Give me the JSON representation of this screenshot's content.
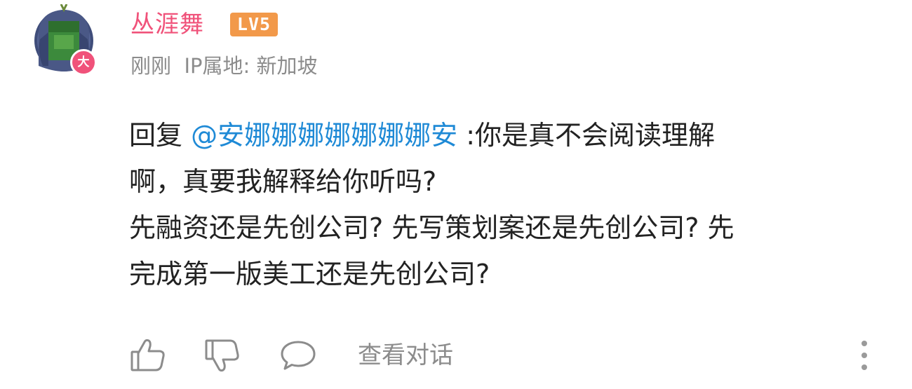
{
  "user": {
    "name": "丛涯舞",
    "level_badge": "LV5",
    "avatar_badge_text": "大",
    "name_color": "#f0527a"
  },
  "meta": {
    "time": "刚刚",
    "ip_location": "IP属地: 新加坡"
  },
  "comment": {
    "reply_prefix": "回复",
    "mention": "@安娜娜娜娜娜娜娜安",
    "line1_rest": ":你是真不会阅读理解",
    "line2": "啊，真要我解释给你听吗?",
    "line3": "先融资还是先创公司? 先写策划案还是先创公司? 先",
    "line4": "完成第一版美工还是先创公司?"
  },
  "actions": {
    "like_icon": "thumbs-up-icon",
    "dislike_icon": "thumbs-down-icon",
    "reply_icon": "comment-bubble-icon",
    "view_conversation_label": "查看对话",
    "more_icon": "more-vertical-icon"
  },
  "colors": {
    "mention": "#1f8ad6",
    "level_badge": "#f2994a",
    "meta_text": "#8c8c8c"
  }
}
